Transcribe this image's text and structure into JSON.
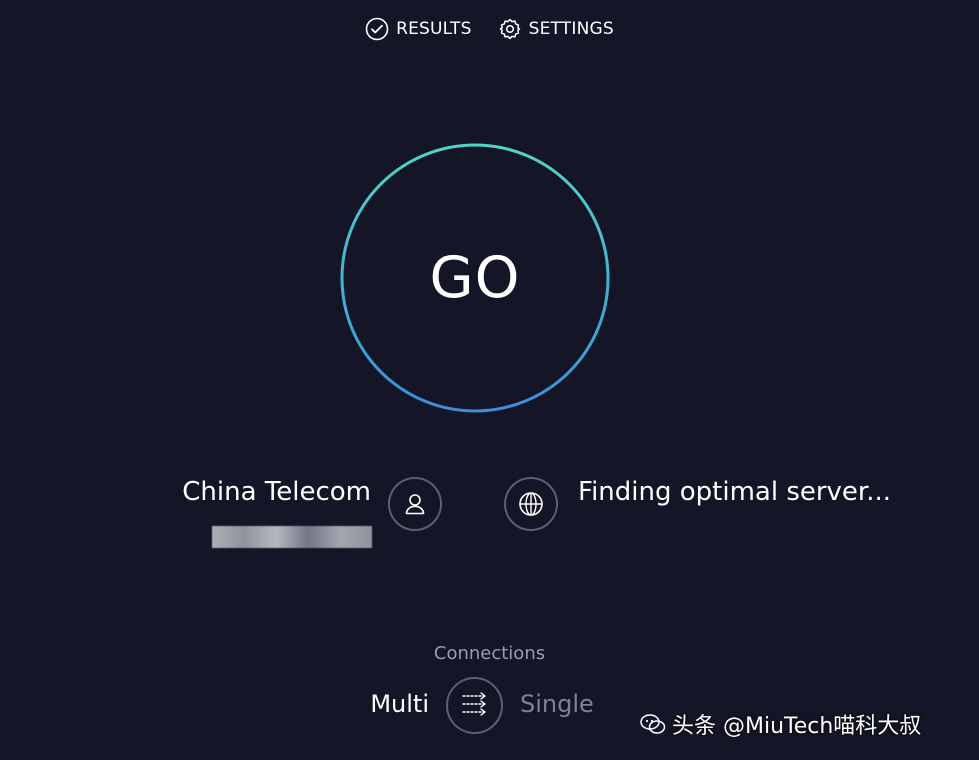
{
  "nav": {
    "results_label": "RESULTS",
    "settings_label": "SETTINGS"
  },
  "go_button": {
    "label": "GO"
  },
  "provider": {
    "name": "China Telecom"
  },
  "server": {
    "status": "Finding optimal server..."
  },
  "connections": {
    "label": "Connections",
    "multi_label": "Multi",
    "single_label": "Single",
    "selected": "Multi"
  },
  "watermark": {
    "text": "头条 @MiuTech喵科大叔"
  },
  "colors": {
    "background": "#141526",
    "ring_start": "#4fd6c7",
    "ring_end": "#3b8fd8",
    "icon_border": "#5b5e78",
    "muted_text": "#9a9cb0"
  },
  "icons": {
    "results": "check-circle-icon",
    "settings": "gear-icon",
    "provider": "user-icon",
    "server": "globe-icon",
    "connections": "arrows-icon",
    "watermark": "chat-bubble-icon"
  }
}
